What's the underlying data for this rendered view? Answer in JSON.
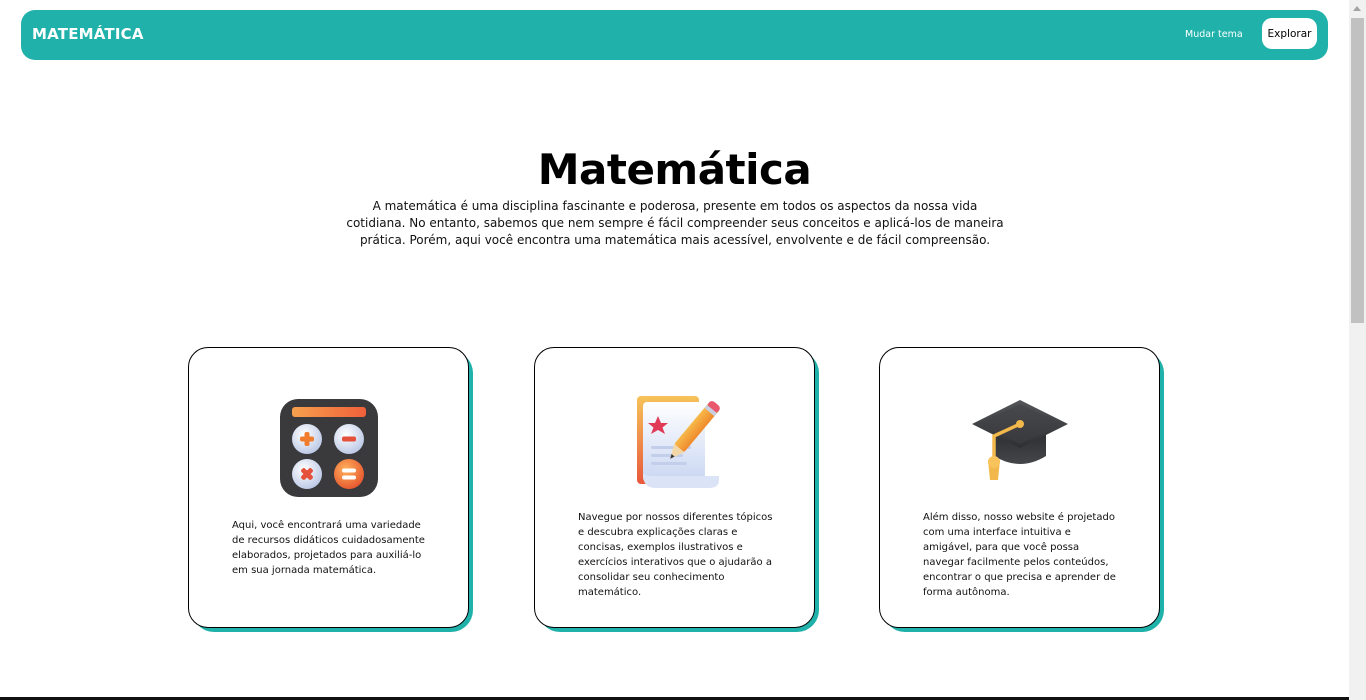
{
  "navbar": {
    "brand": "MATEMÁTICA",
    "theme_button": "Mudar tema",
    "explore_button": "Explorar"
  },
  "hero": {
    "title": "Matemática",
    "text": "A matemática é uma disciplina fascinante e poderosa, presente em todos os aspectos da nossa vida cotidiana. No entanto, sabemos que nem sempre é fácil compreender seus conceitos e aplicá-los de maneira prática. Porém, aqui você encontra uma matemática mais acessível, envolvente e de fácil compreensão."
  },
  "cards": [
    {
      "icon": "calculator-icon",
      "text": "Aqui, você encontrará uma variedade de recursos didáticos cuidadosamente elaborados, projetados para auxiliá-lo em sua jornada matemática."
    },
    {
      "icon": "certificate-pencil-icon",
      "text": "Navegue por nossos diferentes tópicos e descubra explicações claras e concisas, exemplos ilustrativos e exercícios interativos que o ajudarão a consolidar seu conhecimento matemático."
    },
    {
      "icon": "graduation-cap-icon",
      "text": "Além disso, nosso website é projetado com uma interface intuitiva e amigável, para que você possa navegar facilmente pelos conteúdos, encontrar o que precisa e aprender de forma autônoma."
    }
  ],
  "colors": {
    "accent": "#20b2aa",
    "card_border": "#000000",
    "background": "#ffffff"
  }
}
